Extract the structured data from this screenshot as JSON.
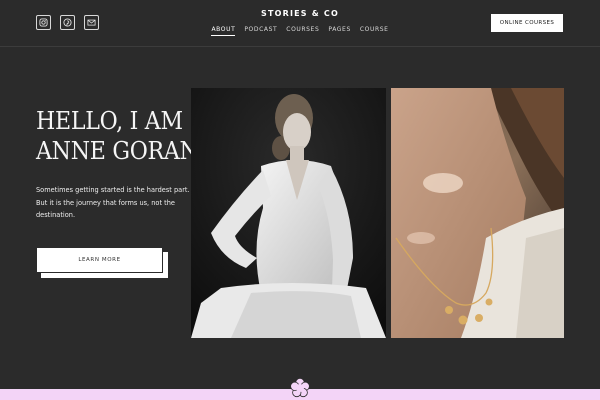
{
  "header": {
    "brand": "STORIES & CO",
    "nav": [
      "ABOUT",
      "PODCAST",
      "COURSES",
      "PAGES",
      "COURSE"
    ],
    "active_nav": "ABOUT",
    "cta_label": "ONLINE COURSES",
    "socials": [
      "instagram-icon",
      "pinterest-icon",
      "email-icon"
    ]
  },
  "hero": {
    "title_line1": "HELLO, I AM",
    "title_line2": "ANNE GORAN",
    "text": "Sometimes getting started is the hardest part. But it is the journey that forms us, not the destination.",
    "button_label": "LEARN MORE"
  },
  "colors": {
    "background": "#2b2b2b",
    "accent_strip": "#f3d4f7",
    "button": "#ffffff"
  }
}
